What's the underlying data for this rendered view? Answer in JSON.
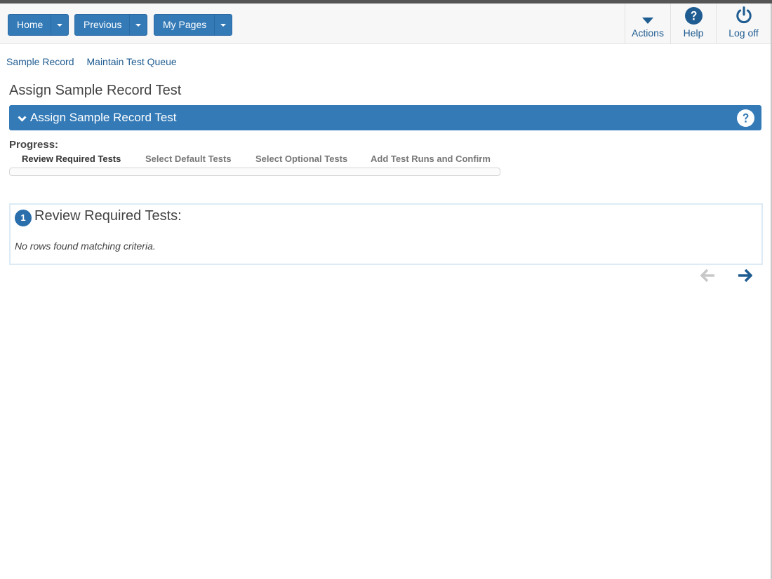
{
  "header": {
    "nav_buttons": [
      {
        "label": "Home"
      },
      {
        "label": "Previous"
      },
      {
        "label": "My Pages"
      }
    ],
    "actions": [
      {
        "label": "Actions",
        "icon": "caret-down-icon"
      },
      {
        "label": "Help",
        "icon": "question-circle-icon"
      },
      {
        "label": "Log off",
        "icon": "power-icon"
      }
    ]
  },
  "breadcrumb": [
    "Sample Record",
    "Maintain Test Queue"
  ],
  "page_title": "Assign Sample Record Test",
  "panel": {
    "title": "Assign Sample Record Test",
    "help_icon": "question-circle-icon"
  },
  "progress": {
    "label": "Progress:",
    "steps": [
      {
        "label": "Review Required Tests",
        "active": true
      },
      {
        "label": "Select Default Tests",
        "active": false
      },
      {
        "label": "Select Optional Tests",
        "active": false
      },
      {
        "label": "Add Test Runs and Confirm",
        "active": false
      }
    ],
    "percent": 0
  },
  "section": {
    "step_number": "1",
    "title": "Review Required Tests:",
    "empty_message": "No rows found matching criteria."
  },
  "pager": {
    "prev_icon": "arrow-left-icon",
    "next_icon": "arrow-right-icon",
    "prev_enabled": false
  },
  "colors": {
    "primary": "#337ab7",
    "link": "#1f5c91",
    "disabled": "#c8c8c8"
  }
}
